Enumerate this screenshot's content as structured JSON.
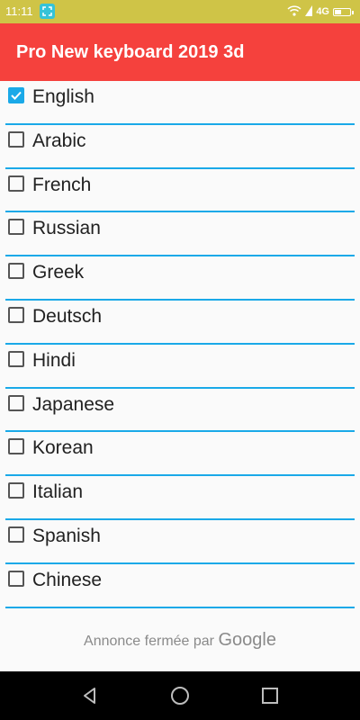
{
  "status_bar": {
    "time": "11:11",
    "network": "4G",
    "background_color": "#cfc447",
    "icons": [
      "screenshot-icon",
      "wifi-icon",
      "signal-icon",
      "battery-icon"
    ]
  },
  "app_bar": {
    "title": "Pro New keyboard 2019 3d",
    "background_color": "#f5413d"
  },
  "languages": [
    {
      "label": "English",
      "checked": true
    },
    {
      "label": "Arabic",
      "checked": false
    },
    {
      "label": "French",
      "checked": false
    },
    {
      "label": "Russian",
      "checked": false
    },
    {
      "label": "Greek",
      "checked": false
    },
    {
      "label": "Deutsch",
      "checked": false
    },
    {
      "label": "Hindi",
      "checked": false
    },
    {
      "label": "Japanese",
      "checked": false
    },
    {
      "label": "Korean",
      "checked": false
    },
    {
      "label": "Italian",
      "checked": false
    },
    {
      "label": "Spanish",
      "checked": false
    },
    {
      "label": "Chinese",
      "checked": false
    }
  ],
  "divider_color": "#1aa9e8",
  "ad": {
    "text": "Annonce fermée par",
    "brand": "Google"
  },
  "nav_bar": {
    "icons": [
      "back-icon",
      "home-icon",
      "recents-icon"
    ]
  }
}
